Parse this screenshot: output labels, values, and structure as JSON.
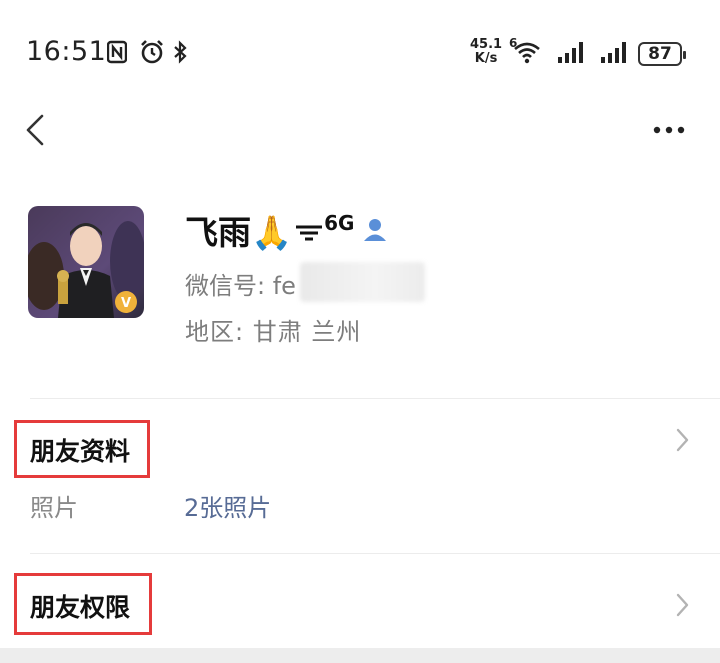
{
  "status_bar": {
    "time": "16:51",
    "net_speed_value": "45.1",
    "net_speed_unit": "K/s",
    "wifi_label": "6",
    "battery": "87"
  },
  "profile": {
    "nickname": "飞雨🙏",
    "nickname_signal": "6G",
    "wechat_id_label": "微信号: fe",
    "region_label": "地区: 甘肃 兰州"
  },
  "friend_info": {
    "title": "朋友资料",
    "photos_label": "照片",
    "photos_value": "2张照片"
  },
  "friend_permissions": {
    "title": "朋友权限"
  },
  "colors": {
    "highlight": "#e53b3b",
    "link": "#576b95",
    "secondary_text": "#7d7d7d"
  }
}
